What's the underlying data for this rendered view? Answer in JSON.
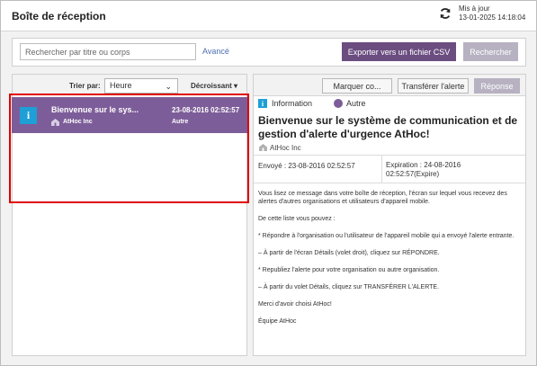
{
  "header": {
    "title": "Boîte de réception",
    "updated_label": "Mis à jour",
    "updated_time": "13-01-2025 14:18:04"
  },
  "search": {
    "placeholder": "Rechercher par titre ou corps",
    "advanced_label": "Avancé",
    "export_label": "Exporter vers un fichier CSV",
    "search_label": "Rechercher"
  },
  "sort": {
    "label": "Trier par:",
    "selected": "Heure",
    "order": "Décroissant ▾"
  },
  "messages": [
    {
      "title": "Bienvenue sur le sys...",
      "date": "23-08-2016 02:52:57",
      "sender": "AtHoc Inc",
      "type": "Autre",
      "icon": "info-icon"
    }
  ],
  "toolbar": {
    "mark_label": "Marquer co...",
    "forward_label": "Transférer l'alerte",
    "reply_label": "Réponse"
  },
  "legend": {
    "info_label": "Information",
    "other_label": "Autre"
  },
  "detail": {
    "title": "Bienvenue sur le système de communication et de gestion d'alerte d'urgence AtHoc!",
    "sender": "AtHoc Inc",
    "sent": "Envoyé : 23-08-2016 02:52:57",
    "expiry": "Expiration : 24-08-2016\n02:52:57(Expire)",
    "paragraphs": [
      "Vous lisez ce message dans votre boîte de réception, l'écran sur lequel vous recevez des alertes d'autres organisations et utilisateurs d'appareil mobile.",
      "De cette liste vous pouvez :",
      "* Répondre à l'organisation ou l'utilisateur de l'appareil mobile qui a envoyé l'alerte entrante.",
      "– À partir de l'écran Détails (volet droit), cliquez sur RÉPONDRE.",
      "* Republiez l'alerte pour votre organisation ou autre organisation.",
      "– À partir du volet Détails, cliquez sur TRANSFÉRER L'ALERTE.",
      "Merci d'avoir choisi AtHoc!",
      "Équipe AtHoc"
    ]
  },
  "colors": {
    "accent": "#6b4d80",
    "selected_row": "#7d5d99",
    "info_blue": "#1e9fd6",
    "highlight_red": "#e00000"
  }
}
